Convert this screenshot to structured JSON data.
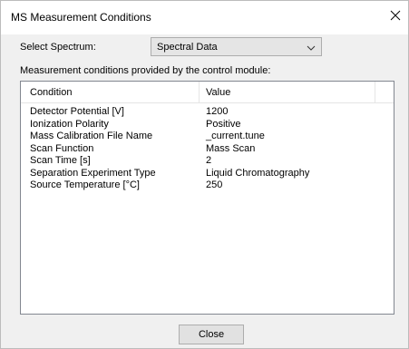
{
  "window": {
    "title": "MS Measurement Conditions"
  },
  "spectrum": {
    "label": "Select Spectrum:",
    "selected": "Spectral Data"
  },
  "section_label": "Measurement conditions provided by the control module:",
  "table": {
    "columns": [
      "Condition",
      "Value"
    ],
    "rows": [
      {
        "condition": "Detector Potential [V]",
        "value": "1200"
      },
      {
        "condition": "Ionization Polarity",
        "value": "Positive"
      },
      {
        "condition": "Mass Calibration File Name",
        "value": "_current.tune"
      },
      {
        "condition": "Scan Function",
        "value": "Mass Scan"
      },
      {
        "condition": "Scan Time [s]",
        "value": "2"
      },
      {
        "condition": "Separation Experiment Type",
        "value": "Liquid Chromatography"
      },
      {
        "condition": "Source Temperature [°C]",
        "value": "250"
      }
    ]
  },
  "buttons": {
    "close": "Close"
  },
  "icons": {
    "close_window": "close-icon",
    "dropdown": "chevron-down-icon"
  }
}
